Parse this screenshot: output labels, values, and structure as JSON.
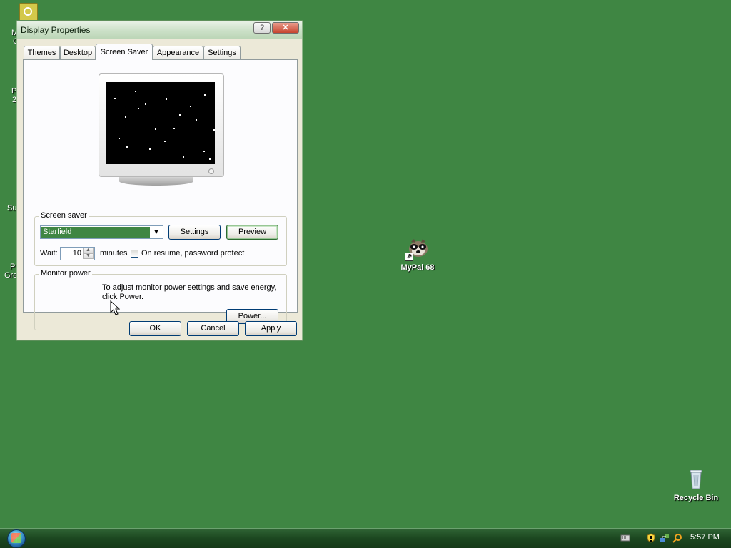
{
  "desktop": {
    "icons": [
      {
        "label": "MyPal 68",
        "icon": "mypal-icon"
      },
      {
        "label": "Recycle Bin",
        "icon": "recycle-bin-icon"
      }
    ],
    "partial_labels": [
      "M",
      "C",
      "P",
      "2",
      "Su",
      "Pl",
      "Gre"
    ]
  },
  "window": {
    "title": "Display Properties",
    "help_button_label": "?",
    "close_button_label": "✕",
    "tabs": [
      "Themes",
      "Desktop",
      "Screen Saver",
      "Appearance",
      "Settings"
    ],
    "active_tab": "Screen Saver",
    "screen_saver": {
      "group_label": "Screen saver",
      "selected": "Starfield",
      "settings_button": "Settings",
      "preview_button": "Preview",
      "wait_label": "Wait:",
      "wait_value": "10",
      "minutes_label": "minutes",
      "password_checkbox_label": "On resume, password protect",
      "password_checked": false
    },
    "monitor_power": {
      "group_label": "Monitor power",
      "description": "To adjust monitor power settings and save energy, click Power.",
      "power_button": "Power..."
    },
    "buttons": {
      "ok": "OK",
      "cancel": "Cancel",
      "apply": "Apply"
    }
  },
  "taskbar": {
    "clock": "5:57 PM",
    "tray_icons": [
      "keyboard-icon",
      "security-shield-icon",
      "network-icon",
      "search-icon"
    ]
  },
  "colors": {
    "desktop_background": "#3f8643",
    "selection": "#3f8643",
    "taskbar": "#1c4720",
    "window_face": "#ece9d8"
  }
}
